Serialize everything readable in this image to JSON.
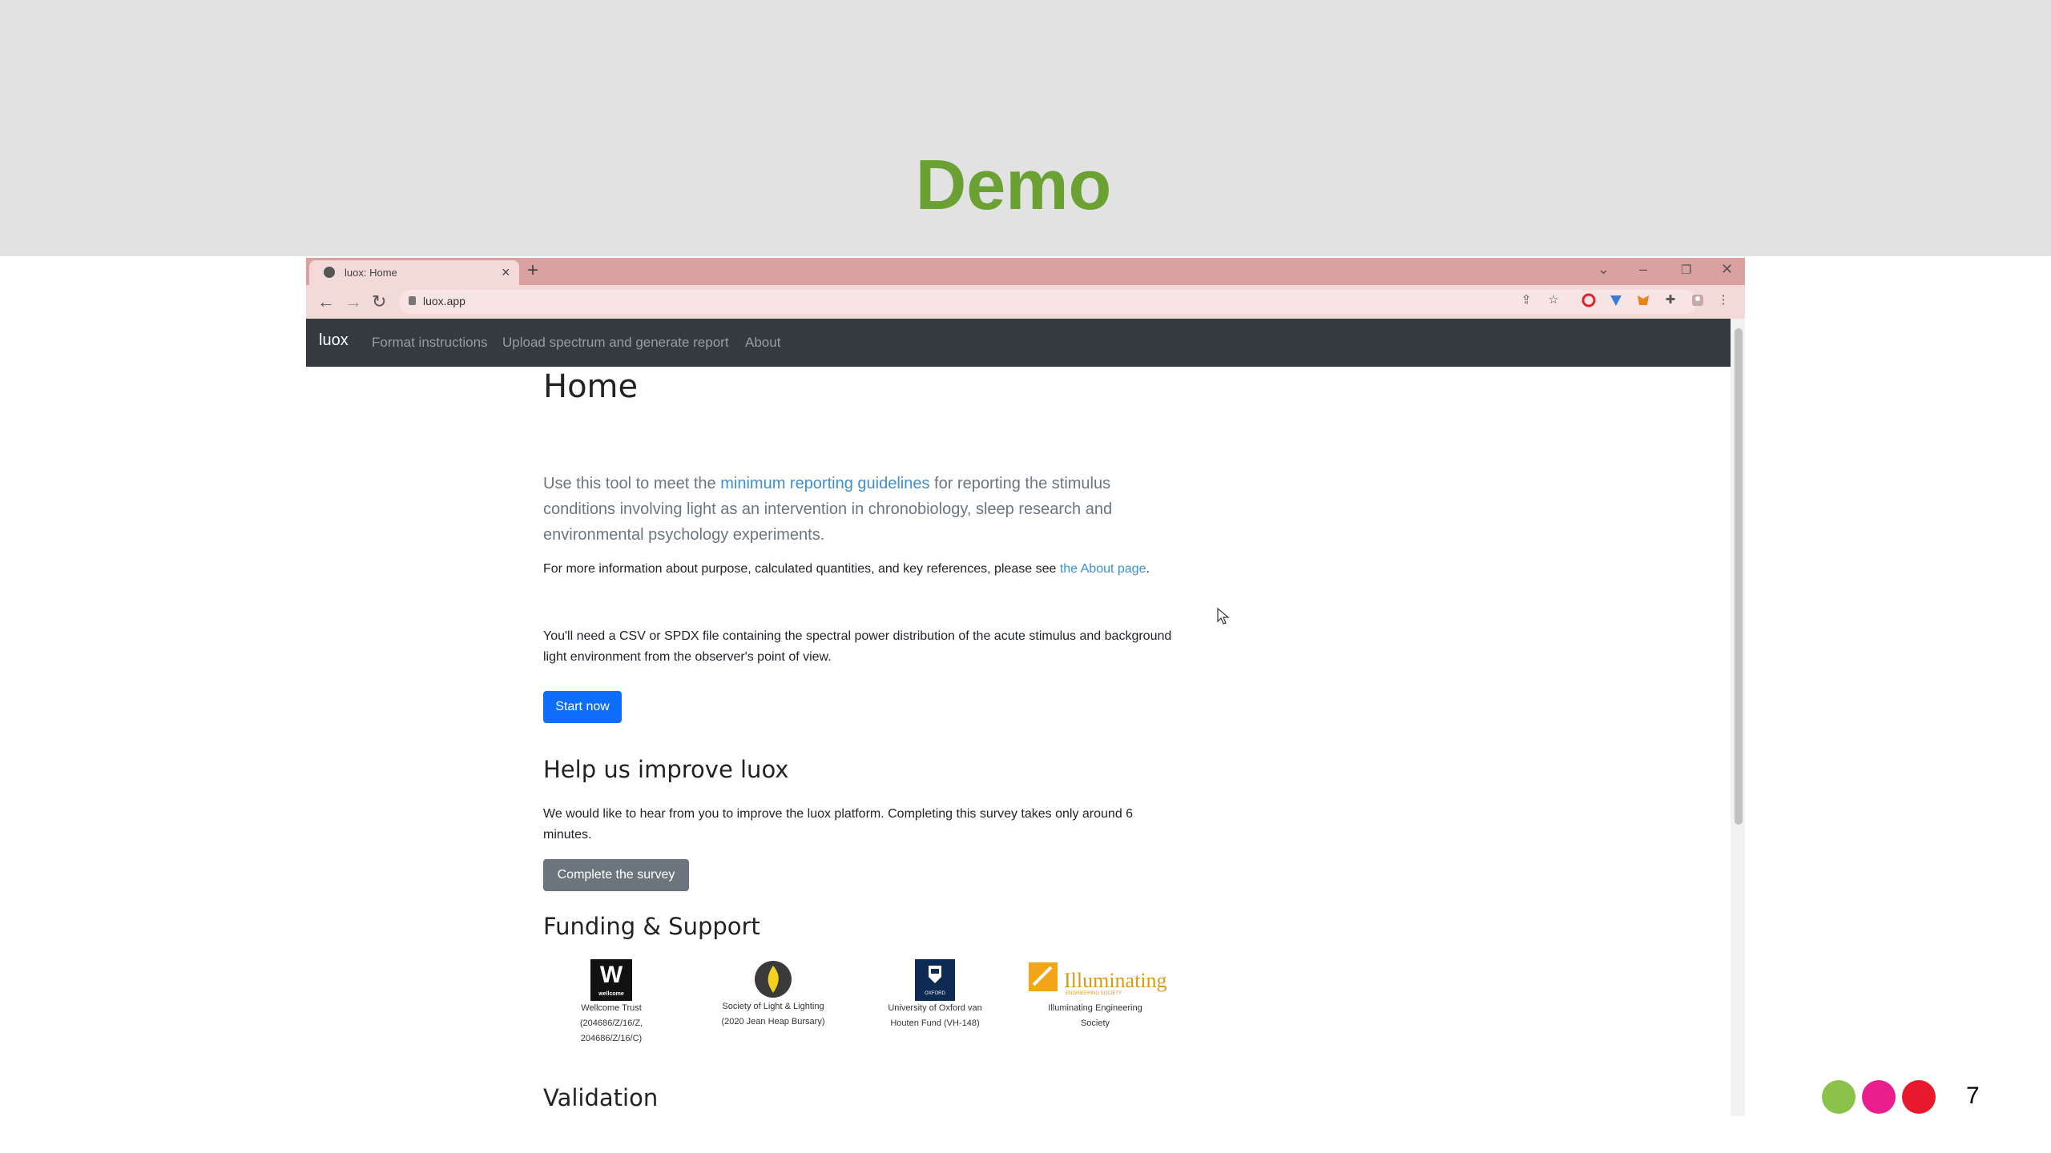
{
  "slide": {
    "title": "Demo",
    "page_number": "7",
    "dot_colors": [
      "#8bc34a",
      "#e91e8c",
      "#e8192c"
    ]
  },
  "browser": {
    "tab_title": "luox: Home",
    "tab_close": "×",
    "new_tab": "+",
    "url": "luox.app",
    "window_controls": {
      "minimize": "–",
      "restore": "❐",
      "close": "✕",
      "tab_search": "⌄"
    }
  },
  "navbar": {
    "brand": "luox",
    "links": [
      "Format instructions",
      "Upload spectrum and generate report",
      "About"
    ]
  },
  "home": {
    "title": "Home",
    "lead_before": "Use this tool to meet the ",
    "lead_link": "minimum reporting guidelines",
    "lead_after": " for reporting the stimulus conditions involving light as an intervention in chronobiology, sleep research and environmental psychology experiments.",
    "info_before": "For more information about purpose, calculated quantities, and key references, please see ",
    "info_link": "the About page",
    "info_after": ".",
    "need_text": "You'll need a CSV or SPDX file containing the spectral power distribution of the acute stimulus and background light environment from the observer's point of view.",
    "start_button": "Start now"
  },
  "improve": {
    "title": "Help us improve luox",
    "text": "We would like to hear from you to improve the luox platform. Completing this survey takes only around 6 minutes.",
    "survey_button": "Complete the survey"
  },
  "funding": {
    "title": "Funding & Support",
    "logos": [
      {
        "mark": "W",
        "mark_sub": "wellcome",
        "caption_lines": [
          "Wellcome Trust",
          "(204686/Z/16/Z,",
          "204686/Z/16/C)"
        ]
      },
      {
        "mark": "",
        "caption_lines": [
          "Society of Light & Lighting",
          "(2020 Jean Heap Bursary)"
        ]
      },
      {
        "mark": "",
        "mark_sub": "OXFORD",
        "caption_lines": [
          "University of Oxford van",
          "Houten Fund (VH-148)"
        ]
      },
      {
        "mark": "Illuminating",
        "mark_sub": "ENGINEERING SOCIETY",
        "caption_lines": [
          "Illuminating Engineering",
          "Society"
        ]
      }
    ]
  },
  "validation": {
    "title": "Validation"
  }
}
